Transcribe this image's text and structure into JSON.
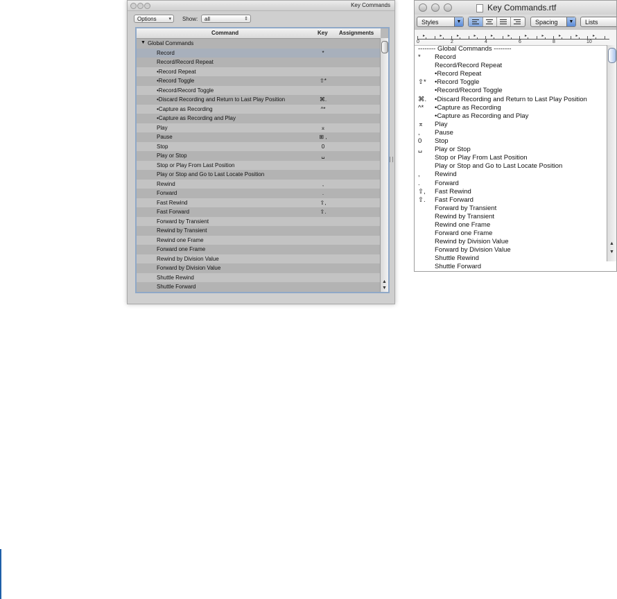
{
  "kc_window": {
    "title": "Key Commands",
    "options_label": "Options",
    "show_label": "Show:",
    "show_value": "all",
    "columns": {
      "command": "Command",
      "key": "Key",
      "assignments": "Assignments"
    },
    "rows": [
      {
        "command": "Global Commands",
        "key": "",
        "group": true
      },
      {
        "command": "Record",
        "key": "*",
        "selected": true
      },
      {
        "command": "Record/Record Repeat",
        "key": ""
      },
      {
        "command": "•Record Repeat",
        "key": ""
      },
      {
        "command": "•Record Toggle",
        "key": "⇧*"
      },
      {
        "command": "•Record/Record Toggle",
        "key": ""
      },
      {
        "command": "•Discard Recording and Return to Last Play Position",
        "key": "⌘."
      },
      {
        "command": "•Capture as Recording",
        "key": "^*"
      },
      {
        "command": "•Capture as Recording and Play",
        "key": ""
      },
      {
        "command": "Play",
        "key": "⌅"
      },
      {
        "command": "Pause",
        "key": "⊞ ,"
      },
      {
        "command": "Stop",
        "key": "0"
      },
      {
        "command": "Play or Stop",
        "key": "␣"
      },
      {
        "command": "Stop or Play From Last Position",
        "key": ""
      },
      {
        "command": "Play or Stop and Go to Last Locate Position",
        "key": ""
      },
      {
        "command": "Rewind",
        "key": ","
      },
      {
        "command": "Forward",
        "key": "."
      },
      {
        "command": "Fast Rewind",
        "key": "⇧,"
      },
      {
        "command": "Fast Forward",
        "key": "⇧."
      },
      {
        "command": "Forward by Transient",
        "key": ""
      },
      {
        "command": "Rewind by Transient",
        "key": ""
      },
      {
        "command": "Rewind one Frame",
        "key": ""
      },
      {
        "command": "Forward one Frame",
        "key": ""
      },
      {
        "command": "Rewind by Division Value",
        "key": ""
      },
      {
        "command": "Forward by Division Value",
        "key": ""
      },
      {
        "command": "Shuttle Rewind",
        "key": ""
      },
      {
        "command": "Shuttle Forward",
        "key": ""
      }
    ]
  },
  "rtf_window": {
    "title": "Key Commands.rtf",
    "styles_label": "Styles",
    "spacing_label": "Spacing",
    "lists_label": "Lists",
    "ruler_numbers": [
      "0",
      "2",
      "4",
      "6",
      "8",
      "10"
    ],
    "lines": [
      {
        "key": "",
        "text": "-------- Global Commands --------",
        "heading": true
      },
      {
        "key": "*",
        "text": "Record"
      },
      {
        "key": "",
        "text": "Record/Record Repeat"
      },
      {
        "key": "",
        "text": "•Record Repeat"
      },
      {
        "key": "⇧*",
        "text": "•Record Toggle"
      },
      {
        "key": "",
        "text": "•Record/Record Toggle"
      },
      {
        "key": "⌘.",
        "text": "•Discard Recording and Return to Last Play Position"
      },
      {
        "key": "^*",
        "text": "•Capture as Recording"
      },
      {
        "key": "",
        "text": "•Capture as Recording and Play"
      },
      {
        "key": "⌅",
        "text": "Play"
      },
      {
        "key": ",",
        "text": "Pause"
      },
      {
        "key": "0",
        "text": "Stop"
      },
      {
        "key": "␣",
        "text": "Play or Stop"
      },
      {
        "key": "",
        "text": "Stop or Play From Last Position"
      },
      {
        "key": "",
        "text": "Play or Stop and Go to Last Locate Position"
      },
      {
        "key": ",",
        "text": "Rewind"
      },
      {
        "key": ".",
        "text": "Forward"
      },
      {
        "key": "⇧,",
        "text": "Fast Rewind"
      },
      {
        "key": "⇧.",
        "text": "Fast Forward"
      },
      {
        "key": "",
        "text": "Forward by Transient"
      },
      {
        "key": "",
        "text": "Rewind by Transient"
      },
      {
        "key": "",
        "text": "Rewind one Frame"
      },
      {
        "key": "",
        "text": "Forward one Frame"
      },
      {
        "key": "",
        "text": "Rewind by Division Value"
      },
      {
        "key": "",
        "text": "Forward by Division Value"
      },
      {
        "key": "",
        "text": "Shuttle Rewind"
      },
      {
        "key": "",
        "text": "Shuttle Forward"
      }
    ]
  }
}
